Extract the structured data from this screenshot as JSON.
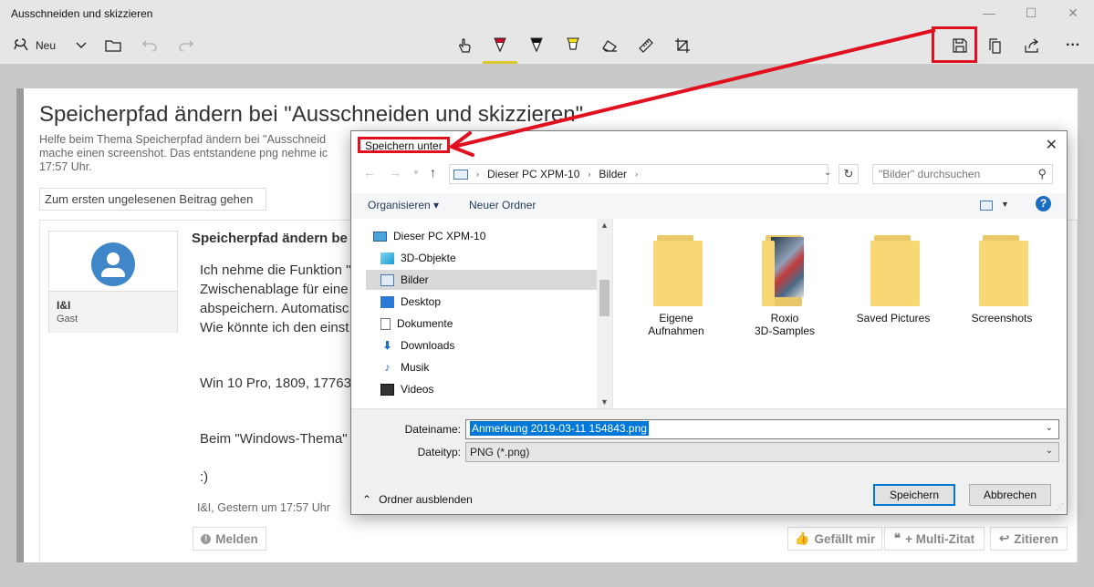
{
  "app": {
    "title": "Ausschneiden und skizzieren",
    "window_controls": {
      "minimize": "—",
      "maximize": "☐",
      "close": "✕"
    }
  },
  "toolbar": {
    "new_label": "Neu",
    "icons": [
      "new-snip-icon",
      "chevron-down-icon",
      "folder-open-icon",
      "undo-icon",
      "redo-icon",
      "touch-writing-icon",
      "ballpoint-pen-icon",
      "pencil-icon",
      "highlighter-icon",
      "eraser-icon",
      "ruler-icon",
      "crop-icon",
      "save-icon",
      "copy-icon",
      "share-icon",
      "more-icon"
    ],
    "more_label": "···",
    "accent_color": "#d9c92f",
    "highlight_color": "#e01020"
  },
  "page": {
    "title": "Speicherpfad ändern bei \"Ausschneiden und skizzieren\"",
    "subtitle_lines": [
      "Helfe beim Thema Speicherpfad ändern bei \"Ausschneid",
      "mache einen screenshot. Das entstandene png nehme ic",
      "17:57 Uhr."
    ],
    "first_unread_button": "Zum ersten ungelesenen Beitrag gehen",
    "author_name": "I&I",
    "author_role": "Gast",
    "post_title": "Speicherpfad ändern be",
    "post_lines": [
      "Ich nehme die Funktion \"",
      "Zwischenablage für eine",
      "abspeichern. Automatisc",
      "Wie könnte ich den einst",
      "Win 10 Pro, 1809, 17763.",
      "Beim \"Windows-Thema\"",
      ":)"
    ],
    "post_meta": "I&I, Gestern um 17:57 Uhr",
    "report_button": "Melden",
    "like_button": "Gefällt mir",
    "multiquote_button": "+ Multi-Zitat",
    "quote_button": "Zitieren"
  },
  "dialog": {
    "title": "Speichern unter",
    "close": "✕",
    "address_segments": [
      "Dieser PC XPM-10",
      "Bilder"
    ],
    "search_placeholder": "\"Bilder\" durchsuchen",
    "organize_label": "Organisieren ▾",
    "new_folder_label": "Neuer Ordner",
    "help_label": "?",
    "tree": [
      {
        "label": "Dieser PC XPM-10",
        "icon": "computer-icon"
      },
      {
        "label": "3D-Objekte",
        "icon": "3d-objects-icon"
      },
      {
        "label": "Bilder",
        "icon": "pictures-icon",
        "selected": true
      },
      {
        "label": "Desktop",
        "icon": "desktop-icon"
      },
      {
        "label": "Dokumente",
        "icon": "documents-icon"
      },
      {
        "label": "Downloads",
        "icon": "downloads-icon"
      },
      {
        "label": "Musik",
        "icon": "music-icon"
      },
      {
        "label": "Videos",
        "icon": "videos-icon"
      }
    ],
    "folders": [
      {
        "line1": "Eigene",
        "line2": "Aufnahmen"
      },
      {
        "line1": "Roxio",
        "line2": "3D-Samples"
      },
      {
        "line1": "Saved Pictures",
        "line2": ""
      },
      {
        "line1": "Screenshots",
        "line2": ""
      }
    ],
    "filename_label": "Dateiname:",
    "filename_value": "Anmerkung 2019-03-11 154843.png",
    "filetype_label": "Dateityp:",
    "filetype_value": "PNG (*.png)",
    "hide_folders_label": "Ordner ausblenden",
    "save_button": "Speichern",
    "cancel_button": "Abbrechen"
  }
}
